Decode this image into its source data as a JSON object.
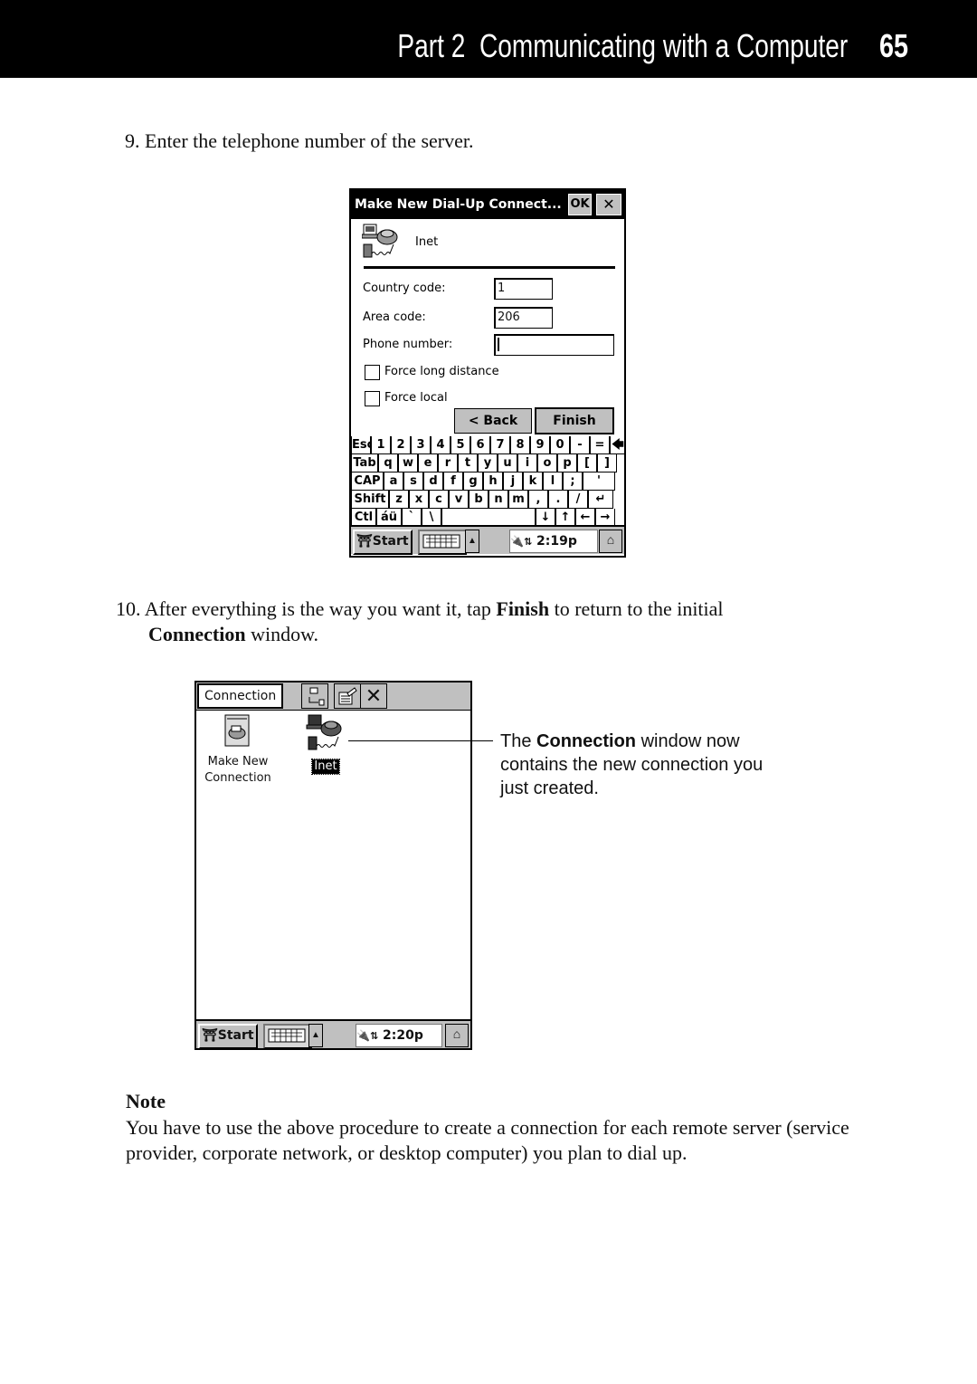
{
  "header": {
    "title": "Part 2  Communicating with a Computer",
    "page_number": "65"
  },
  "step9": {
    "number": "9.",
    "text": "Enter the telephone number of the server."
  },
  "dialog": {
    "title": "Make New Dial-Up Connect...",
    "ok_label": "OK",
    "close_label": "✕",
    "connection_name": "Inet",
    "country_code_label": "Country code:",
    "country_code_value": "1",
    "area_code_label": "Area code:",
    "area_code_value": "206",
    "phone_label": "Phone number:",
    "phone_value": "",
    "force_long_distance_label": "Force long distance",
    "force_local_label": "Force local",
    "back_label": "< Back",
    "finish_label": "Finish"
  },
  "keyboard": {
    "rows": [
      [
        "Esc",
        "1",
        "2",
        "3",
        "4",
        "5",
        "6",
        "7",
        "8",
        "9",
        "0",
        "-",
        "=",
        "🡄"
      ],
      [
        "Tab",
        "q",
        "w",
        "e",
        "r",
        "t",
        "y",
        "u",
        "i",
        "o",
        "p",
        "[",
        "]"
      ],
      [
        "CAP",
        "a",
        "s",
        "d",
        "f",
        "g",
        "h",
        "j",
        "k",
        "l",
        ";",
        "'"
      ],
      [
        "Shift",
        "z",
        "x",
        "c",
        "v",
        "b",
        "n",
        "m",
        ",",
        ".",
        "/",
        "↵"
      ],
      [
        "Ctl",
        "áü",
        "`",
        "\\",
        " ",
        "↓",
        "↑",
        "←",
        "→"
      ]
    ]
  },
  "taskbar1": {
    "start_label": "Start",
    "time": "2:19p"
  },
  "step10": {
    "number": "10.",
    "text_before": "After everything is the way you want it, tap ",
    "bold1": "Finish",
    "text_middle": " to return to the initial",
    "bold2": "Connection",
    "text_after": " window."
  },
  "connection_window": {
    "title": "Connection",
    "items": [
      {
        "label_line1": "Make New",
        "label_line2": "Connection",
        "icon": "make-new-connection-icon"
      },
      {
        "label_line1": "Inet",
        "label_line2": "",
        "icon": "dialup-connection-icon"
      }
    ]
  },
  "taskbar2": {
    "start_label": "Start",
    "time": "2:20p"
  },
  "callout": {
    "text_before": "The ",
    "bold": "Connection",
    "text_after": " window now contains the new connection you just created."
  },
  "note": {
    "heading": "Note",
    "body": "You have to use the above procedure to create a connection for each remote server (service provider, corporate network, or desktop computer) you plan to dial up."
  }
}
